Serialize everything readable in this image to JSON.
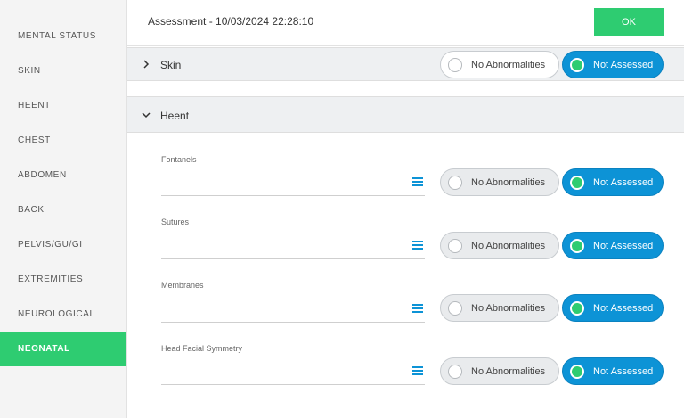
{
  "sidebar": {
    "items": [
      {
        "label": "MENTAL STATUS"
      },
      {
        "label": "SKIN"
      },
      {
        "label": "HEENT"
      },
      {
        "label": "CHEST"
      },
      {
        "label": "ABDOMEN"
      },
      {
        "label": "BACK"
      },
      {
        "label": "PELVIS/GU/GI"
      },
      {
        "label": "EXTREMITIES"
      },
      {
        "label": "NEUROLOGICAL"
      },
      {
        "label": "NEONATAL"
      }
    ],
    "active": "NEONATAL"
  },
  "header": {
    "title": "Assessment - 10/03/2024 22:28:10",
    "ok_label": "OK"
  },
  "sections": {
    "skin": {
      "title": "Skin",
      "expanded": false,
      "no_abnormalities": "No Abnormalities",
      "not_assessed": "Not Assessed"
    },
    "heent": {
      "title": "Heent",
      "expanded": true,
      "fields": [
        {
          "label": "Fontanels",
          "no_abnormalities": "No Abnormalities",
          "not_assessed": "Not Assessed"
        },
        {
          "label": "Sutures",
          "no_abnormalities": "No Abnormalities",
          "not_assessed": "Not Assessed"
        },
        {
          "label": "Membranes",
          "no_abnormalities": "No Abnormalities",
          "not_assessed": "Not Assessed"
        },
        {
          "label": "Head Facial Symmetry",
          "no_abnormalities": "No Abnormalities",
          "not_assessed": "Not Assessed"
        }
      ]
    }
  },
  "colors": {
    "accent_green": "#2ecc71",
    "selected_blue": "#0d93d6"
  }
}
